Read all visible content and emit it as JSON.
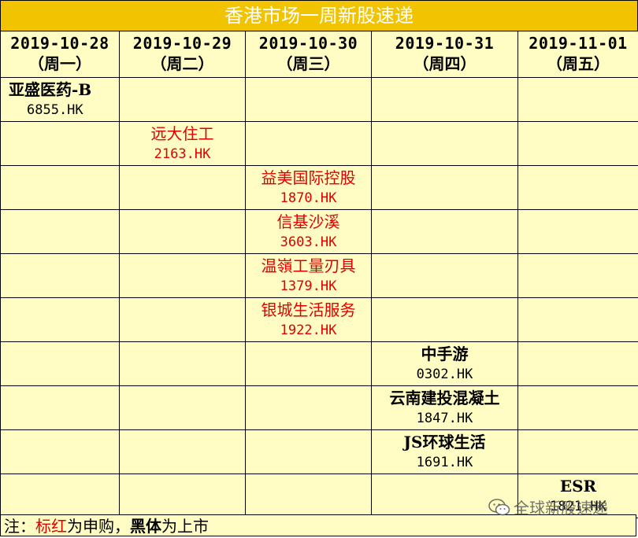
{
  "title": "香港市场一周新股速递",
  "columns": [
    {
      "date": "2019-10-28",
      "weekday": "（周一）"
    },
    {
      "date": "2019-10-29",
      "weekday": "（周二）"
    },
    {
      "date": "2019-10-30",
      "weekday": "（周三）"
    },
    {
      "date": "2019-10-31",
      "weekday": "（周四）"
    },
    {
      "date": "2019-11-01",
      "weekday": "（周五）"
    }
  ],
  "rows": [
    {
      "col": 0,
      "name": "亚盛医药-B",
      "code": "6855.HK",
      "status": "listing"
    },
    {
      "col": 1,
      "name": "远大住工",
      "code": "2163.HK",
      "status": "subscription"
    },
    {
      "col": 2,
      "name": "益美国际控股",
      "code": "1870.HK",
      "status": "subscription"
    },
    {
      "col": 2,
      "name": "信基沙溪",
      "code": "3603.HK",
      "status": "subscription"
    },
    {
      "col": 2,
      "name": "温嶺工量刃具",
      "code": "1379.HK",
      "status": "subscription"
    },
    {
      "col": 2,
      "name": "银城生活服务",
      "code": "1922.HK",
      "status": "subscription"
    },
    {
      "col": 3,
      "name": "中手游",
      "code": "0302.HK",
      "status": "listing"
    },
    {
      "col": 3,
      "name": "云南建投混凝土",
      "code": "1847.HK",
      "status": "listing"
    },
    {
      "col": 3,
      "name": "JS环球生活",
      "code": "1691.HK",
      "status": "listing"
    },
    {
      "col": 4,
      "name": "ESR",
      "code": "1821.HK",
      "status": "listing"
    }
  ],
  "note": {
    "prefix": "注：",
    "red_label": "标红",
    "middle": "为申购，",
    "bold_label": "黑体",
    "suffix": "为上市"
  },
  "watermark": {
    "text": "全球新股速递",
    "icon": "wechat-icon"
  },
  "colors": {
    "title_bg": "#f2c300",
    "cell_bg": "#fffdc4",
    "subscription": "#e00000",
    "listing": "#000000"
  }
}
